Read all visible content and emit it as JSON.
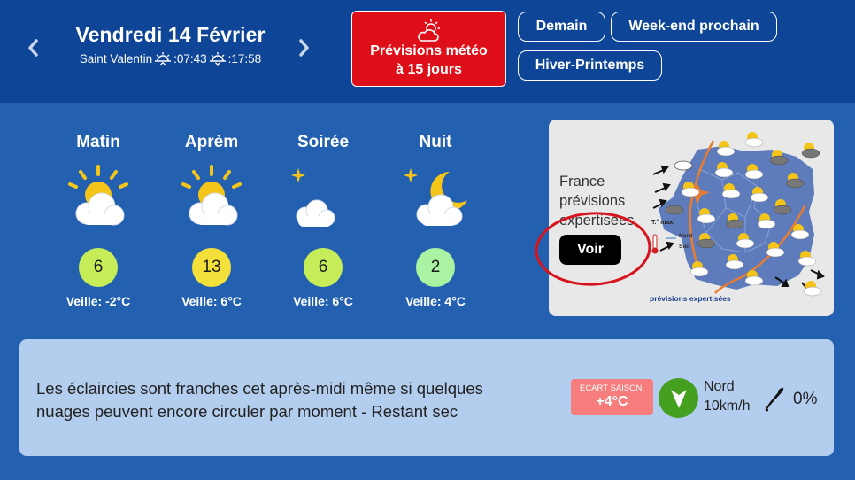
{
  "header": {
    "date": "Vendredi 14 Février",
    "saint": "Saint Valentin",
    "sunrise": ":07:43",
    "sunset": ":17:58",
    "forecast_button": {
      "line1": "Prévisions météo",
      "line2": "à 15 jours"
    },
    "links": {
      "demain": "Demain",
      "weekend": "Week-end prochain",
      "hiver": "Hiver-Printemps"
    }
  },
  "periods": [
    {
      "name": "Matin",
      "temp": "6",
      "veille": "Veille: -2°C",
      "icon": "sun-cloud-icon",
      "color": "#c6ec58"
    },
    {
      "name": "Aprèm",
      "temp": "13",
      "veille": "Veille: 6°C",
      "icon": "sun-cloud-icon",
      "color": "#f4e03a"
    },
    {
      "name": "Soirée",
      "temp": "6",
      "veille": "Veille: 6°C",
      "icon": "moon-cloud-icon",
      "color": "#c6ec58"
    },
    {
      "name": "Nuit",
      "temp": "2",
      "veille": "Veille: 4°C",
      "icon": "moon-cloud-icon",
      "color": "#a9f3a2"
    }
  ],
  "map_card": {
    "text": "France prévisions expertisées",
    "button": "Voir",
    "caption": "prévisions expertisées",
    "legend_t": "T.° maxi",
    "legend_nord": "Nord",
    "legend_sud": "Sud"
  },
  "summary": {
    "text": "Les éclaircies sont franches cet après-midi même si quelques nuages peuvent encore circuler par moment - Restant sec",
    "ecart_label": "ECART SAISON.",
    "ecart_value": "+4°C",
    "wind_direction": "Nord",
    "wind_speed": "10km/h",
    "rain": "0%"
  },
  "colors": {
    "header_bg": "#0e4596",
    "page_bg": "#2361b0",
    "forecast_button": "#df0f19",
    "summary_bg": "#b2cdee",
    "ecart": "#f77c7c",
    "wind": "#46a01f",
    "annotation_circle": "#d7141e"
  }
}
